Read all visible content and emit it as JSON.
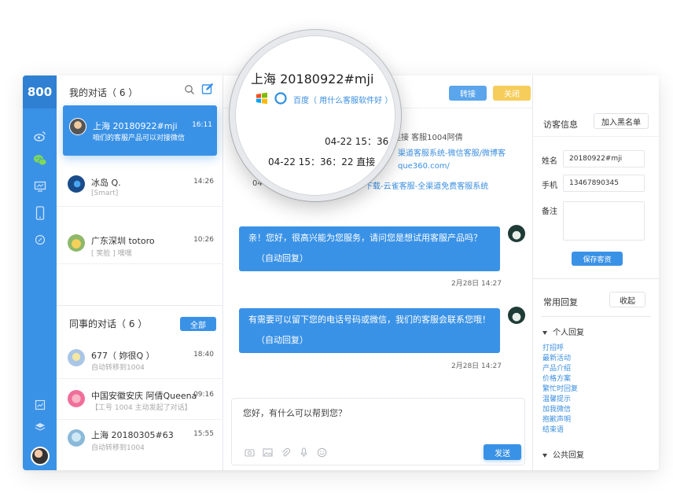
{
  "rail": {
    "logo": "800",
    "icons": [
      "weibo-icon",
      "wechat-icon",
      "monitor-icon",
      "mobile-icon",
      "link-icon",
      "report-icon",
      "layers-icon"
    ]
  },
  "conversations": {
    "title": "我的对话（ 6 ）",
    "items": [
      {
        "name": "上海 20180922#mji",
        "time": "16:11",
        "msg": "咱们的客服产品可以对接微信"
      },
      {
        "name": "冰岛 Q.",
        "time": "14:26",
        "msg": "[Smart]"
      },
      {
        "name": "广东深圳 totoro",
        "time": "10:26",
        "msg": "[ 笑脸 ] 嘿嘿"
      }
    ]
  },
  "colleagues": {
    "title": "同事的对话（ 6 ）",
    "all_label": "全部",
    "items": [
      {
        "name": "677（ 妳很Q ）",
        "time": "18:40",
        "msg": "自动转移到1004"
      },
      {
        "name": "中国安徽安庆 阿倩Queena",
        "time": "09:16",
        "msg": "【工号 1004 主动发起了对话】"
      },
      {
        "name": "上海 20180305#63",
        "time": "15:55",
        "msg": "自动转移到1004"
      }
    ]
  },
  "chat": {
    "transfer_label": "转接",
    "close_label": "关闭",
    "sys1_tail": "连接 客服1004阿倩",
    "sys2_link": "渠道客服系统-微信客服/微博客",
    "sys3_link": "que360.com/",
    "sys4_prefix": "04",
    "sys4_link": "下载-云雀客服-全渠道免费客服系统",
    "messages": [
      {
        "text": "亲！您好，很高兴能为您服务，请问您是想试用客服产品吗？",
        "auto": "（自动回复）",
        "time": "2月28日 14:27"
      },
      {
        "text": "有需要可以留下您的电话号码或微信，我们的客服会联系您哦！",
        "auto": "（自动回复）",
        "time": "2月28日 14:27"
      }
    ],
    "input_text": "您好，有什么可以帮到您？",
    "send_label": "发送"
  },
  "magnifier": {
    "title": "上海 20180922#mji",
    "source": "百度（ 用什么客服软件好 ）",
    "t1": "04-22 15：36",
    "t2": "04-22 15：36：22 直接"
  },
  "visitor": {
    "title": "访客信息",
    "blacklist_label": "加入黑名单",
    "name_label": "姓名",
    "name_value": "20180922#mji",
    "phone_label": "手机",
    "phone_value": "13467890345",
    "note_label": "备注",
    "save_label": "保存客资"
  },
  "replies": {
    "title": "常用回复",
    "collapse_label": "收起",
    "personal_label": "个人回复",
    "public_label": "公共回复",
    "phrases": [
      "打招呼",
      "最新活动",
      "产品介绍",
      "价格方案",
      "繁忙时回复",
      "温馨提示",
      "加我微信",
      "抱歉声明",
      "结束语"
    ]
  },
  "colors": {
    "primary": "#3a92e6",
    "primary_dark": "#2f80d2",
    "close_yellow": "#f6cd5b",
    "link": "#3a8ee0"
  }
}
